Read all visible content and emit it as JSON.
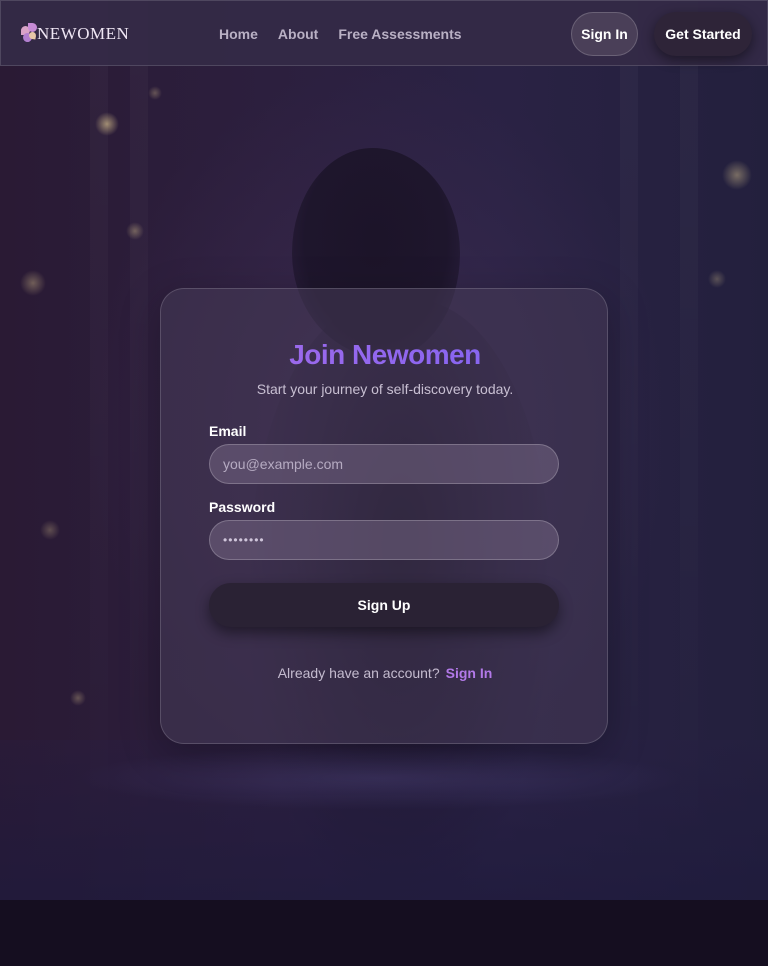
{
  "brand": {
    "logo_text": "NEWOMEN"
  },
  "nav": {
    "links": [
      "Home",
      "About",
      "Free Assessments"
    ],
    "sign_in_label": "Sign In",
    "get_started_label": "Get Started"
  },
  "signup_card": {
    "title": "Join Newomen",
    "subtitle": "Start your journey of self-discovery today.",
    "email": {
      "label": "Email",
      "placeholder": "you@example.com",
      "value": ""
    },
    "password": {
      "label": "Password",
      "masked_value": "••••••••"
    },
    "submit_label": "Sign Up",
    "footer_prompt": "Already have an account?",
    "footer_link": "Sign In"
  },
  "colors": {
    "title_gradient_start": "#a76ce8",
    "title_gradient_end": "#7a64ee",
    "link_accent": "#b279e8",
    "page_background": "#120c1c"
  }
}
